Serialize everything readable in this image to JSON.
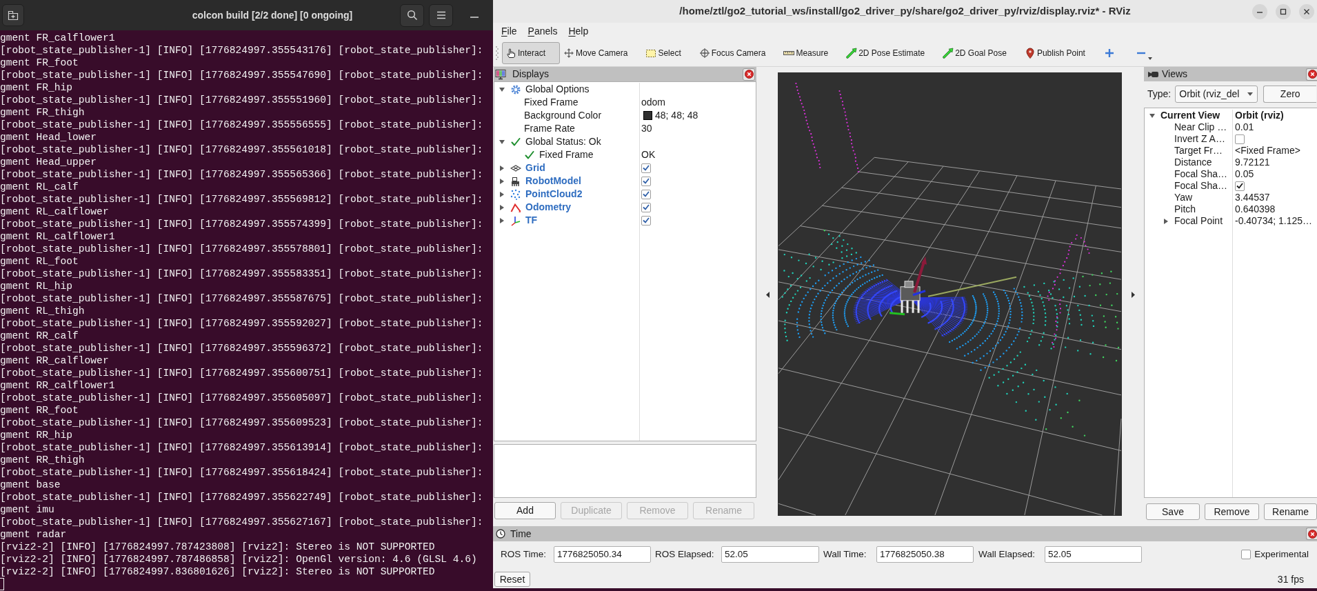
{
  "terminal": {
    "title": "colcon build [2/2 done] [0 ongoing]",
    "lines": [
      "gment FR_calflower1",
      "[robot_state_publisher-1] [INFO] [1776824997.355543176] [robot_state_publisher]:",
      "gment FR_foot",
      "[robot_state_publisher-1] [INFO] [1776824997.355547690] [robot_state_publisher]:",
      "gment FR_hip",
      "[robot_state_publisher-1] [INFO] [1776824997.355551960] [robot_state_publisher]:",
      "gment FR_thigh",
      "[robot_state_publisher-1] [INFO] [1776824997.355556555] [robot_state_publisher]:",
      "gment Head_lower",
      "[robot_state_publisher-1] [INFO] [1776824997.355561018] [robot_state_publisher]:",
      "gment Head_upper",
      "[robot_state_publisher-1] [INFO] [1776824997.355565366] [robot_state_publisher]:",
      "gment RL_calf",
      "[robot_state_publisher-1] [INFO] [1776824997.355569812] [robot_state_publisher]:",
      "gment RL_calflower",
      "[robot_state_publisher-1] [INFO] [1776824997.355574399] [robot_state_publisher]:",
      "gment RL_calflower1",
      "[robot_state_publisher-1] [INFO] [1776824997.355578801] [robot_state_publisher]:",
      "gment RL_foot",
      "[robot_state_publisher-1] [INFO] [1776824997.355583351] [robot_state_publisher]:",
      "gment RL_hip",
      "[robot_state_publisher-1] [INFO] [1776824997.355587675] [robot_state_publisher]:",
      "gment RL_thigh",
      "[robot_state_publisher-1] [INFO] [1776824997.355592027] [robot_state_publisher]:",
      "gment RR_calf",
      "[robot_state_publisher-1] [INFO] [1776824997.355596372] [robot_state_publisher]:",
      "gment RR_calflower",
      "[robot_state_publisher-1] [INFO] [1776824997.355600751] [robot_state_publisher]:",
      "gment RR_calflower1",
      "[robot_state_publisher-1] [INFO] [1776824997.355605097] [robot_state_publisher]:",
      "gment RR_foot",
      "[robot_state_publisher-1] [INFO] [1776824997.355609523] [robot_state_publisher]:",
      "gment RR_hip",
      "[robot_state_publisher-1] [INFO] [1776824997.355613914] [robot_state_publisher]:",
      "gment RR_thigh",
      "[robot_state_publisher-1] [INFO] [1776824997.355618424] [robot_state_publisher]:",
      "gment base",
      "[robot_state_publisher-1] [INFO] [1776824997.355622749] [robot_state_publisher]:",
      "gment imu",
      "[robot_state_publisher-1] [INFO] [1776824997.355627167] [robot_state_publisher]:",
      "gment radar",
      "[rviz2-2] [INFO] [1776824997.787423808] [rviz2]: Stereo is NOT SUPPORTED",
      "[rviz2-2] [INFO] [1776824997.787486858] [rviz2]: OpenGl version: 4.6 (GLSL 4.6)",
      "[rviz2-2] [INFO] [1776824997.836801626] [rviz2]: Stereo is NOT SUPPORTED"
    ]
  },
  "rviz": {
    "title": "/home/ztl/go2_tutorial_ws/install/go2_driver_py/share/go2_driver_py/rviz/display.rviz* - RViz",
    "menu": [
      {
        "label": "File",
        "mnemonic": true
      },
      {
        "label": "Panels",
        "mnemonic": true
      },
      {
        "label": "Help",
        "mnemonic": true
      }
    ],
    "tools": [
      {
        "label": "Interact",
        "selected": true
      },
      {
        "label": "Move Camera",
        "selected": false
      },
      {
        "label": "Select",
        "selected": false
      },
      {
        "label": "Focus Camera",
        "selected": false
      },
      {
        "label": "Measure",
        "selected": false
      },
      {
        "label": "2D Pose Estimate",
        "selected": false
      },
      {
        "label": "2D Goal Pose",
        "selected": false
      },
      {
        "label": "Publish Point",
        "selected": false
      }
    ],
    "displays": {
      "title": "Displays",
      "tree": [
        {
          "label": "Global Options",
          "kind": "group",
          "expanded": true,
          "children": [
            {
              "label": "Fixed Frame",
              "value": "odom"
            },
            {
              "label": "Background Color",
              "value": "48; 48; 48",
              "color": "#303030"
            },
            {
              "label": "Frame Rate",
              "value": "30"
            }
          ]
        },
        {
          "label": "Global Status: Ok",
          "kind": "status",
          "ok": true,
          "expanded": true,
          "children": [
            {
              "label": "Fixed Frame",
              "value": "OK",
              "ok": true
            }
          ]
        },
        {
          "label": "Grid",
          "kind": "display",
          "expanded": false,
          "checked": true
        },
        {
          "label": "RobotModel",
          "kind": "display",
          "expanded": false,
          "checked": true
        },
        {
          "label": "PointCloud2",
          "kind": "display",
          "expanded": false,
          "checked": true
        },
        {
          "label": "Odometry",
          "kind": "display",
          "expanded": false,
          "checked": true
        },
        {
          "label": "TF",
          "kind": "display",
          "expanded": false,
          "checked": true
        }
      ],
      "buttons": [
        {
          "label": "Add",
          "disabled": false
        },
        {
          "label": "Duplicate",
          "disabled": true
        },
        {
          "label": "Remove",
          "disabled": true
        },
        {
          "label": "Rename",
          "disabled": true
        }
      ]
    },
    "views": {
      "title": "Views",
      "type_label": "Type:",
      "type_value": "Orbit (rviz_del",
      "zero_label": "Zero",
      "tree": [
        {
          "label": "Current View",
          "value": "Orbit (rviz)",
          "expanded": true,
          "children": [
            {
              "label": "Near Clip …",
              "value": "0.01"
            },
            {
              "label": "Invert Z A…",
              "kind": "checkbox",
              "checked": false
            },
            {
              "label": "Target Fr…",
              "value": "<Fixed Frame>"
            },
            {
              "label": "Distance",
              "value": "9.72121"
            },
            {
              "label": "Focal Sha…",
              "value": "0.05"
            },
            {
              "label": "Focal Sha…",
              "kind": "checkbox",
              "checked": true
            },
            {
              "label": "Yaw",
              "value": "3.44537"
            },
            {
              "label": "Pitch",
              "value": "0.640398"
            },
            {
              "label": "Focal Point",
              "value": "-0.40734; 1.125…",
              "expanded": false
            }
          ]
        }
      ],
      "buttons": [
        "Save",
        "Remove",
        "Rename"
      ]
    },
    "time": {
      "title": "Time",
      "fields": [
        {
          "label": "ROS Time:",
          "value": "1776825050.34"
        },
        {
          "label": "ROS Elapsed:",
          "value": "52.05"
        },
        {
          "label": "Wall Time:",
          "value": "1776825050.38"
        },
        {
          "label": "Wall Elapsed:",
          "value": "52.05"
        }
      ],
      "experimental": {
        "label": "Experimental",
        "checked": false
      },
      "reset_label": "Reset",
      "fps": "31 fps"
    }
  }
}
